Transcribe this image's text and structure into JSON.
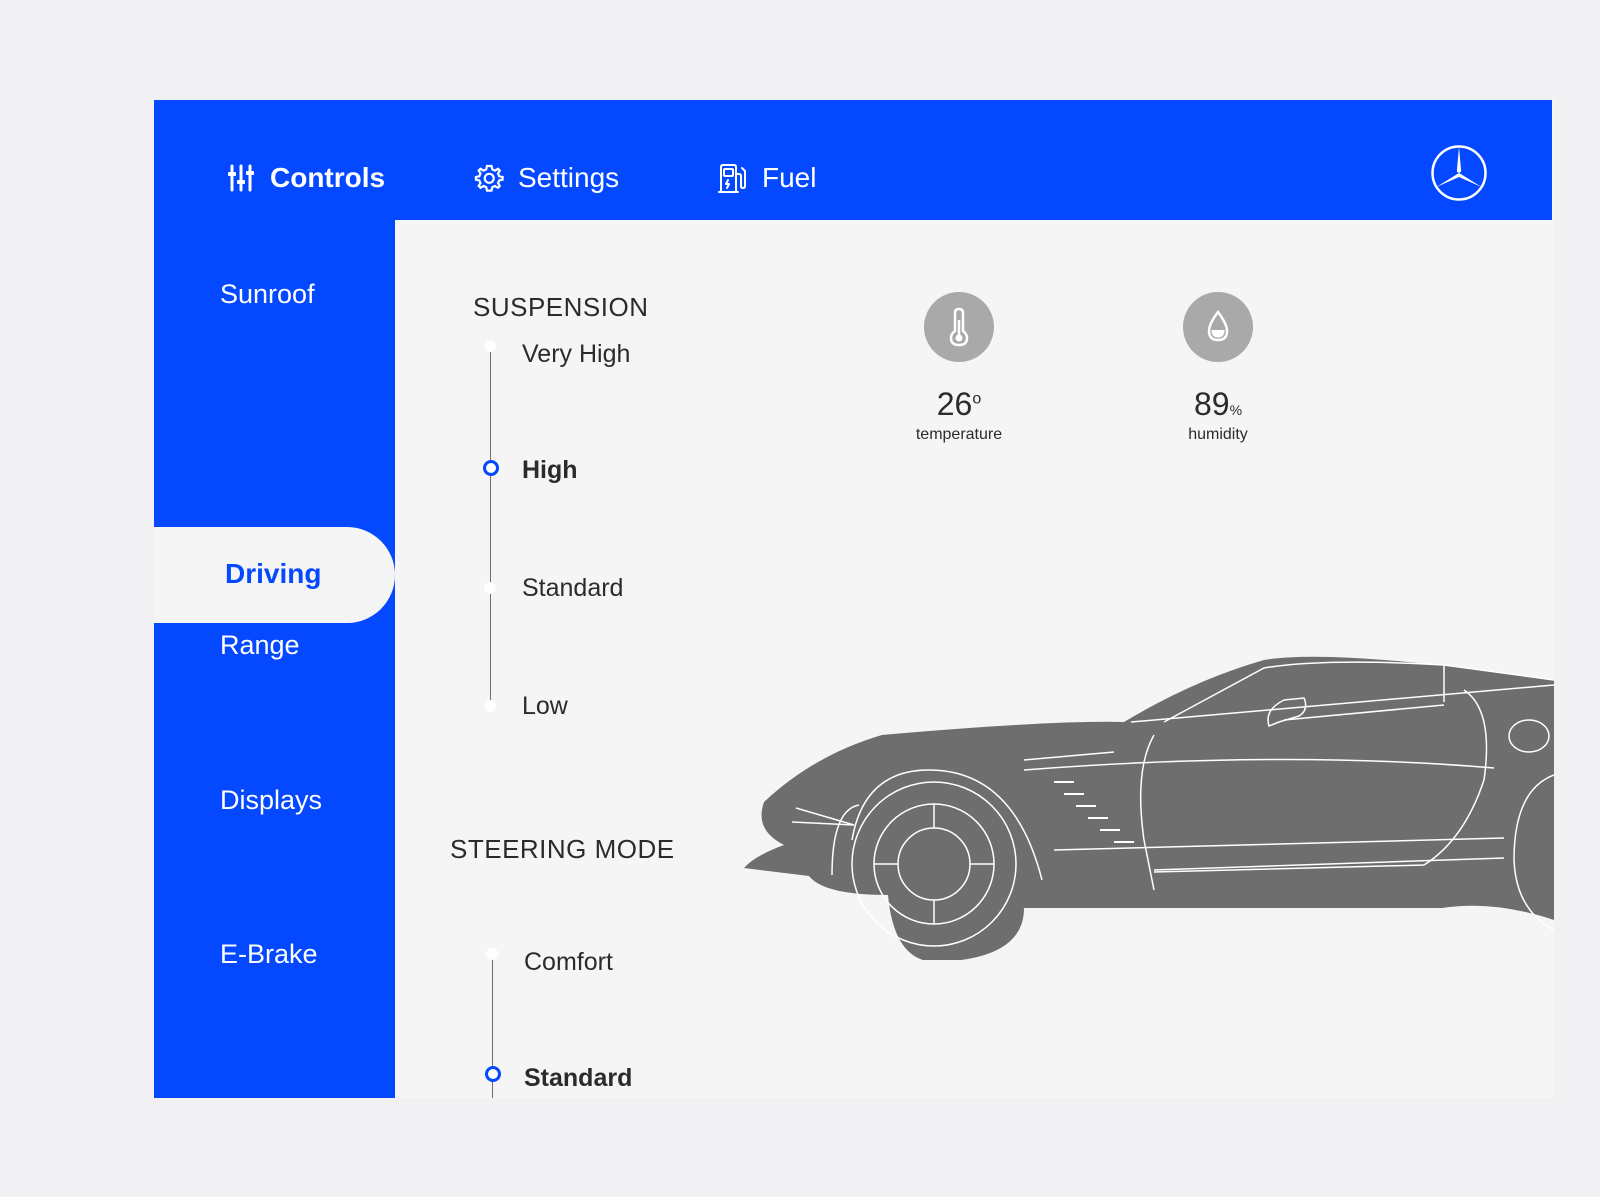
{
  "topbar": {
    "tabs": [
      {
        "label": "Controls",
        "icon": "sliders-icon",
        "active": true
      },
      {
        "label": "Settings",
        "icon": "gear-icon",
        "active": false
      },
      {
        "label": "Fuel",
        "icon": "fuel-pump-icon",
        "active": false
      }
    ],
    "logo": "three-pointed-star-logo"
  },
  "sidebar": {
    "items": [
      {
        "label": "Sunroof"
      },
      {
        "label": "Driving",
        "active": true
      },
      {
        "label": "Range"
      },
      {
        "label": "Displays"
      },
      {
        "label": "E-Brake"
      }
    ]
  },
  "suspension": {
    "title": "SUSPENSION",
    "options": [
      "Very High",
      "High",
      "Standard",
      "Low"
    ],
    "selected": "High"
  },
  "steering": {
    "title": "STEERING MODE",
    "options": [
      "Comfort",
      "Standard"
    ],
    "selected": "Standard"
  },
  "climate": {
    "temperature": {
      "value": "26",
      "unit": "o",
      "label": "temperature",
      "icon": "thermometer-icon"
    },
    "humidity": {
      "value": "89",
      "unit": "%",
      "label": "humidity",
      "icon": "water-drop-icon"
    }
  },
  "colors": {
    "accent": "#0448ff",
    "background": "#f5f5f6",
    "car": "#6e6e6e",
    "icon_circle": "#a9a9a9"
  },
  "illustration": "car-side-view"
}
